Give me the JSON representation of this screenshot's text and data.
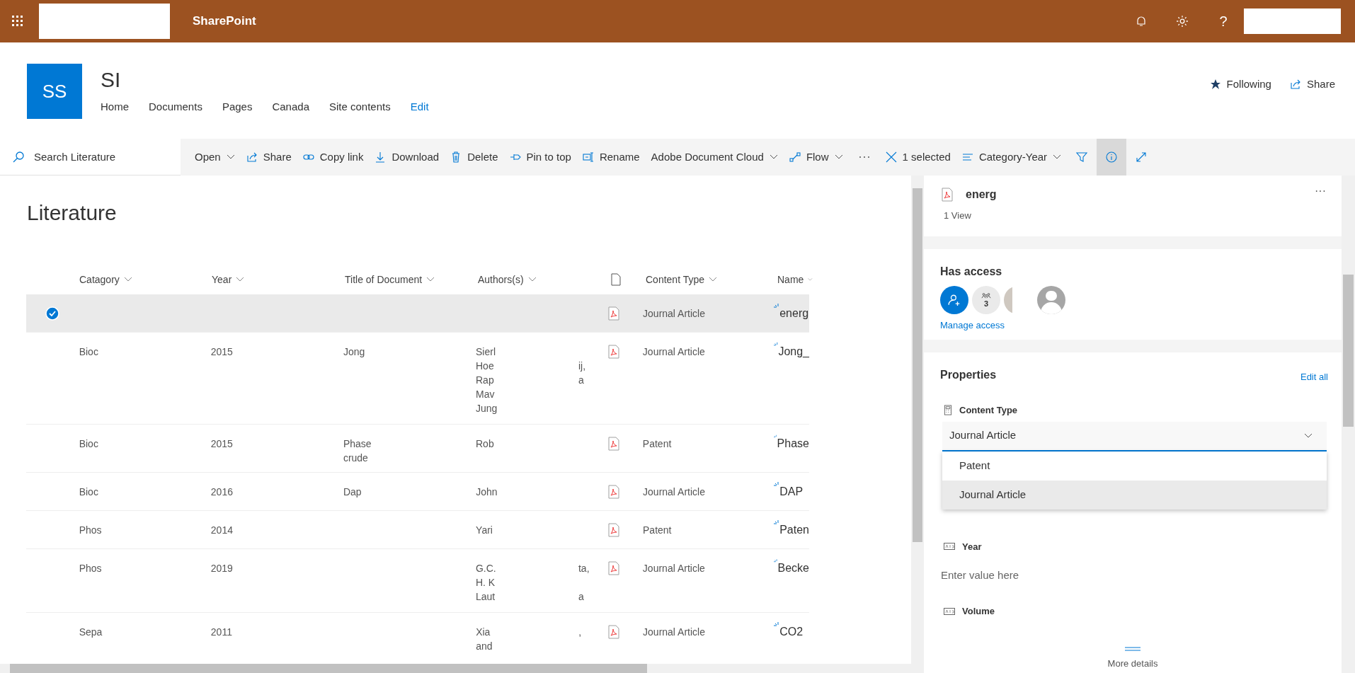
{
  "app_bar": {
    "title": "SharePoint",
    "help": "?"
  },
  "site": {
    "logo": "SS",
    "title": "SI",
    "nav": [
      {
        "label": "Home",
        "kind": "link"
      },
      {
        "label": "Documents",
        "kind": "link"
      },
      {
        "label": "Pages",
        "kind": "link"
      },
      {
        "label": "Canada",
        "kind": "link"
      },
      {
        "label": "Site contents",
        "kind": "link"
      },
      {
        "label": "Edit",
        "kind": "action"
      }
    ],
    "following": "Following",
    "share": "Share"
  },
  "search": {
    "placeholder": "Search Literature"
  },
  "toolbar": {
    "commands": [
      {
        "label": "Open",
        "caret": true
      },
      {
        "label": "Share",
        "caret": false
      },
      {
        "label": "Copy link",
        "caret": false
      },
      {
        "label": "Download",
        "caret": false
      },
      {
        "label": "Delete",
        "caret": false
      },
      {
        "label": "Pin to top",
        "caret": false
      },
      {
        "label": "Rename",
        "caret": false
      },
      {
        "label": "Adobe Document Cloud",
        "caret": true
      },
      {
        "label": "Flow",
        "caret": true
      }
    ],
    "selection": "1 selected",
    "view": "Category-Year",
    "info_selected": true
  },
  "library": {
    "title": "Literature",
    "columns": [
      "Catagory",
      "Year",
      "Title of Document",
      "Authors(s)",
      "Content Type",
      "Name"
    ],
    "rows": [
      {
        "selected": true,
        "category": [],
        "year": "",
        "title": [],
        "authors": [],
        "content_type": "Journal Article",
        "name": "energ"
      },
      {
        "selected": false,
        "category": [
          "Bioc"
        ],
        "year": "2015",
        "title": [
          "Jong"
        ],
        "authors": [
          {
            "text": "Sierl"
          },
          {
            "text": "Hoe",
            "tail": "ij,"
          },
          {
            "text": "Rap",
            "tail": "a"
          },
          {
            "text": "Mav"
          },
          {
            "text": "Jung"
          }
        ],
        "content_type": "Journal Article",
        "name": "Jong_"
      },
      {
        "selected": false,
        "category": [
          "Bioc"
        ],
        "year": "2015",
        "title": [
          "Phase",
          "crude"
        ],
        "authors": [
          {
            "text": "Rob"
          }
        ],
        "content_type": "Patent",
        "name": "Phase"
      },
      {
        "selected": false,
        "category": [
          "Bioc"
        ],
        "year": "2016",
        "title": [
          "Dap"
        ],
        "authors": [
          {
            "text": "John"
          }
        ],
        "content_type": "Journal Article",
        "name": "DAP"
      },
      {
        "selected": false,
        "category": [
          "Phos"
        ],
        "year": "2014",
        "title": [],
        "authors": [
          {
            "text": "Yari"
          }
        ],
        "content_type": "Patent",
        "name": "Paten"
      },
      {
        "selected": false,
        "category": [
          "Phos"
        ],
        "year": "2019",
        "title": [],
        "authors": [
          {
            "text": "G.C.",
            "tail": "ta,"
          },
          {
            "text": "H. K"
          },
          {
            "text": "Laut",
            "tail": "a"
          }
        ],
        "content_type": "Journal Article",
        "name": "Becke"
      },
      {
        "selected": false,
        "category": [
          "Sepa"
        ],
        "year": "2011",
        "title": [],
        "authors": [
          {
            "text": "Xia",
            "tail": ","
          },
          {
            "text": "and"
          }
        ],
        "content_type": "Journal Article",
        "name": "CO2"
      }
    ]
  },
  "details": {
    "file_name": "energ",
    "more": "···",
    "views": "1 View",
    "access": {
      "title": "Has access",
      "group_count": "3",
      "link": "Manage access"
    },
    "properties": {
      "title": "Properties",
      "edit_all": "Edit all",
      "content_type": {
        "label": "Content Type",
        "value": "Journal Article",
        "options": [
          {
            "label": "Patent",
            "selected": false
          },
          {
            "label": "Journal Article",
            "selected": true
          }
        ]
      },
      "fields": [
        {
          "label": "Year",
          "placeholder": "Enter value here"
        },
        {
          "label": "Volume"
        }
      ],
      "more_details": "More details"
    }
  }
}
